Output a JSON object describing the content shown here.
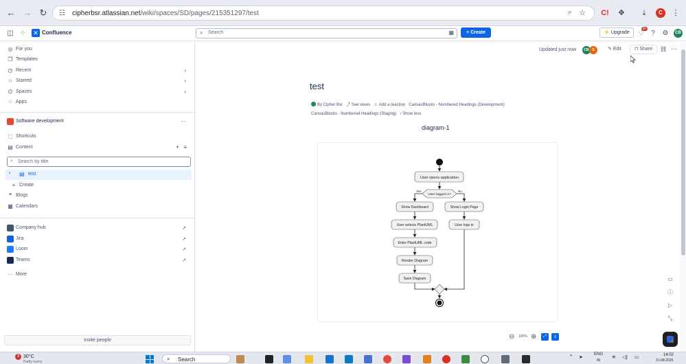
{
  "browser": {
    "url_host": "cipherbsr.atlassian.net",
    "url_path": "/wiki/spaces/SD/pages/215351297/test",
    "profile_initial": "C"
  },
  "topbar": {
    "app_name": "Confluence",
    "search_placeholder": "Search",
    "create_label": "+ Create",
    "upgrade_label": "Upgrade",
    "notification_count": "9+",
    "user_initials": "CB"
  },
  "sidebar": {
    "nav": [
      {
        "label": "For you",
        "icon": "user-circle-icon"
      },
      {
        "label": "Templates",
        "icon": "templates-icon"
      },
      {
        "label": "Recent",
        "icon": "clock-icon"
      },
      {
        "label": "Starred",
        "icon": "star-icon"
      },
      {
        "label": "Spaces",
        "icon": "spaces-icon"
      },
      {
        "label": "Apps",
        "icon": "apps-grid-icon"
      }
    ],
    "space_name": "Software development",
    "space_more": "···",
    "shortcuts_label": "Shortcuts",
    "content_label": "Content",
    "search_placeholder": "Search by title",
    "tree_item": "test",
    "create_label": "Create",
    "blogs_label": "Blogs",
    "calendars_label": "Calendars",
    "apps": [
      {
        "label": "Company hub",
        "color": "#44546f"
      },
      {
        "label": "Jira",
        "color": "#0c66e4"
      },
      {
        "label": "Loom",
        "color": "#1d7afc"
      },
      {
        "label": "Teams",
        "color": "#172b4d"
      }
    ],
    "more_label": "More",
    "invite_label": "Invite people"
  },
  "page": {
    "updated": "Updated just now",
    "avatar1": "CB",
    "avatar2": "S",
    "edit_label": "Edit",
    "share_label": "Share",
    "title": "test",
    "byline_author": "By Cipher Bsr",
    "byline_views": "See views",
    "byline_reaction": "Add a reaction",
    "byline_app1": "CanvasBlocks - Numbered Headings (Development)",
    "byline_app2": "CanvasBlocks - Numbered Headings (Staging)",
    "show_less": "Show less",
    "diagram_heading": "diagram-1",
    "zoom_level": "100%"
  },
  "diagram": {
    "start": "User opens application",
    "decision": "User logged in?",
    "yes": "Yes",
    "no": "No",
    "left": [
      "Show Dashboard",
      "User selects PlantUML",
      "Enter PlantUML code",
      "Render Diagram",
      "Save Diagram"
    ],
    "right": [
      "Show Login Page",
      "User logs in"
    ]
  },
  "taskbar": {
    "weather_badge": "3",
    "temperature": "30°C",
    "weather_desc": "Partly sunny",
    "search_placeholder": "Search",
    "lang": "ENG",
    "lang_sub": "IN",
    "time": "14:02",
    "date": "21-08-2025"
  }
}
